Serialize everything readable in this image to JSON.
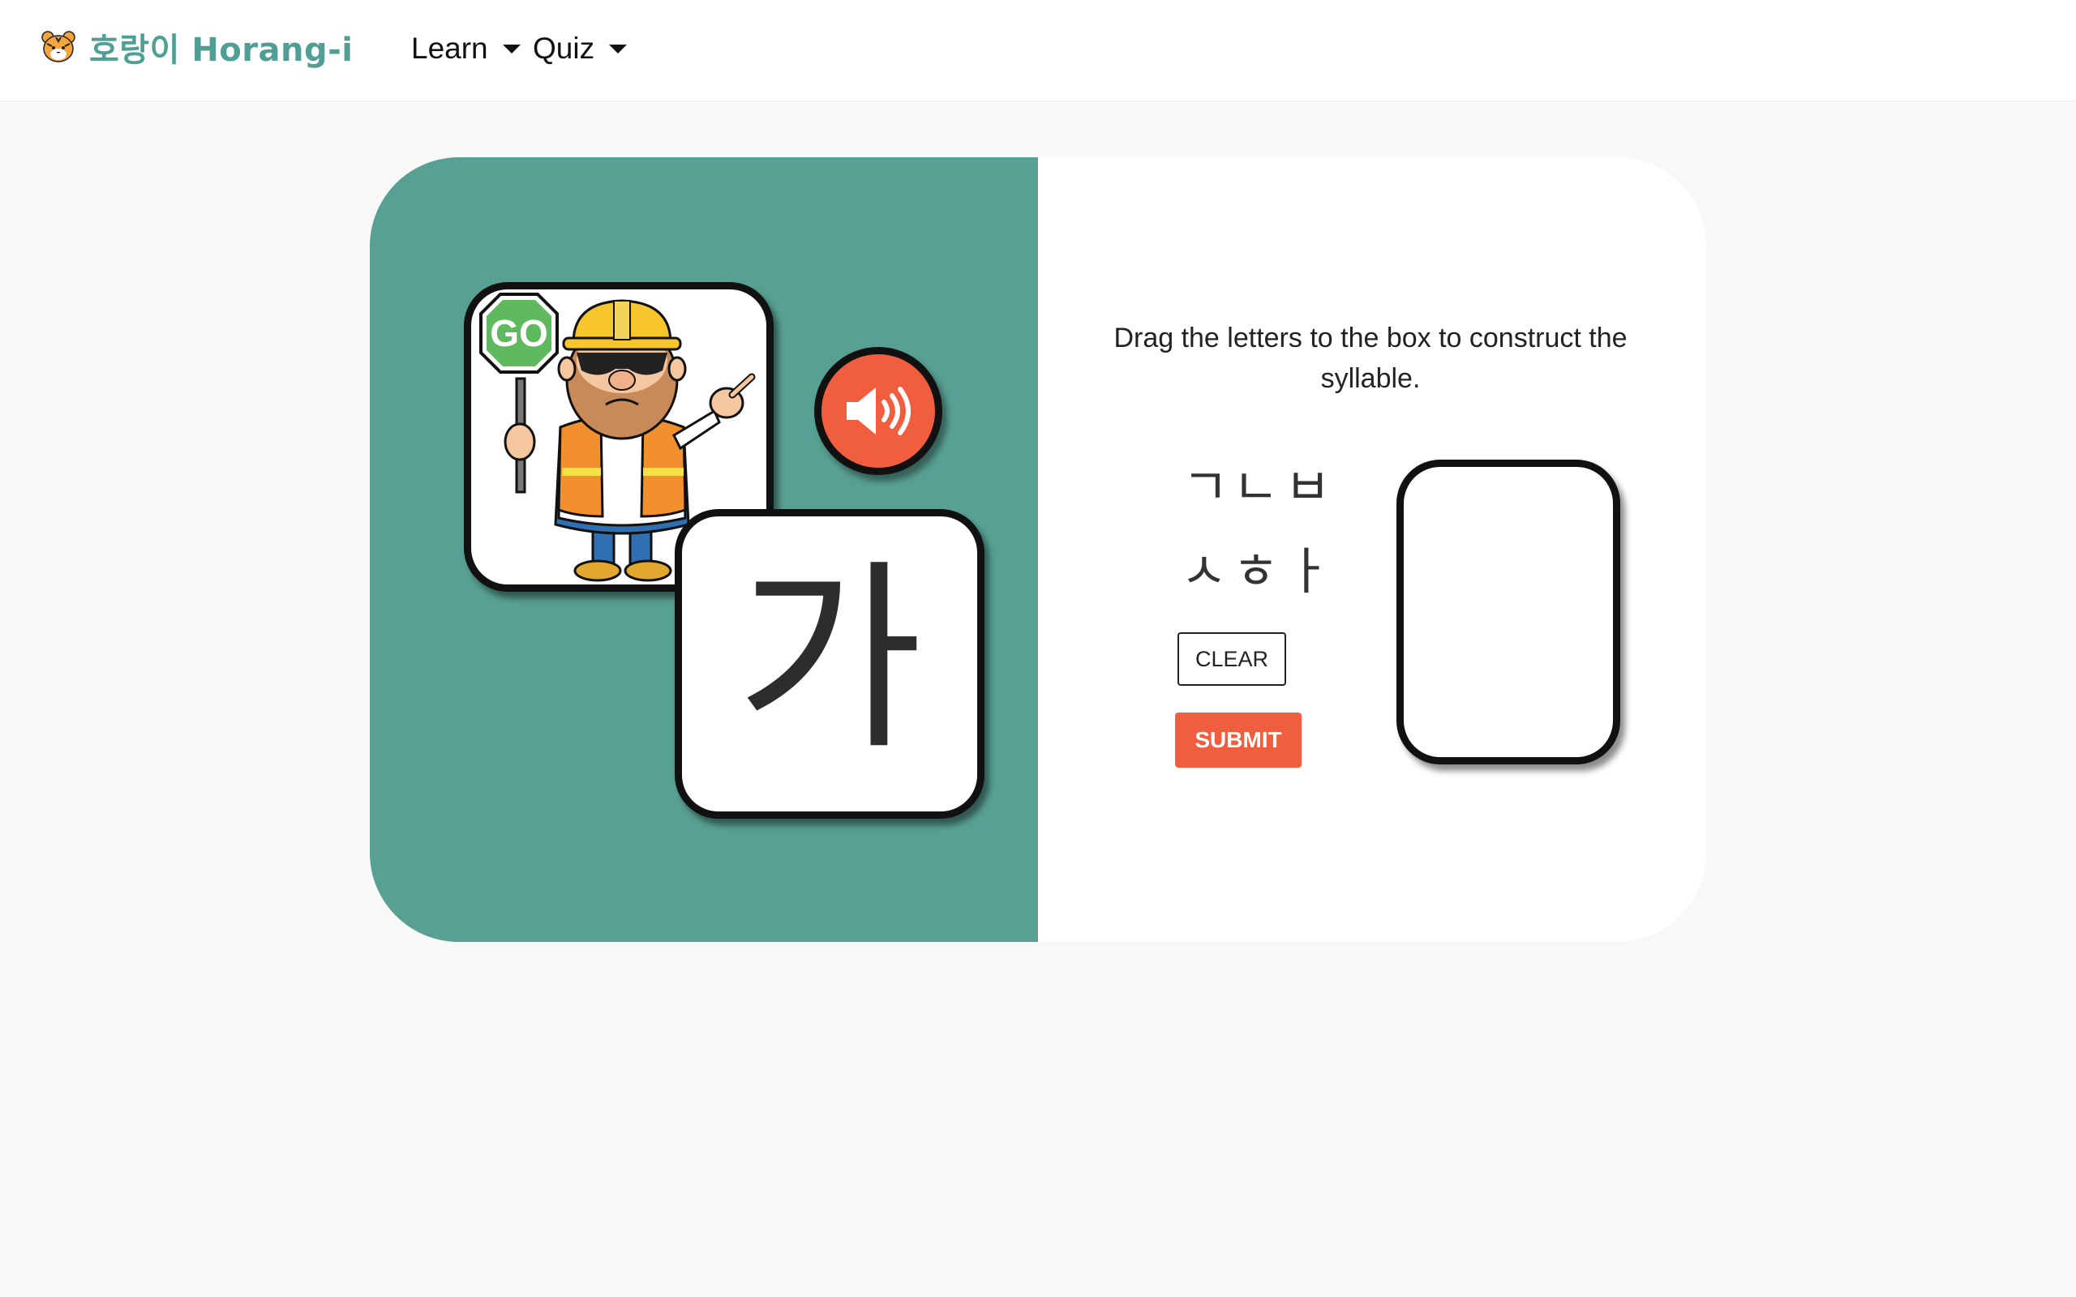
{
  "navbar": {
    "brand_text": "호랑이 Horang-i",
    "brand_icon": "tiger-face-icon",
    "menu": [
      {
        "label": "Learn",
        "icon": "caret-down-icon"
      },
      {
        "label": "Quiz",
        "icon": "caret-down-icon"
      }
    ]
  },
  "lesson": {
    "picture": {
      "sign_text": "GO",
      "subject": "construction-worker-with-go-sign"
    },
    "sound_icon": "speaker-icon",
    "syllable": "가",
    "instructions": "Drag the letters to the box to construct the syllable.",
    "letters": [
      "ㄱ",
      "ㄴ",
      "ㅂ",
      "ㅅ",
      "ㅎ",
      "ㅏ"
    ],
    "clear_label": "CLEAR",
    "submit_label": "SUBMIT"
  },
  "colors": {
    "brand": "#4f9f94",
    "panel": "#58a093",
    "accent": "#f05e3f"
  }
}
